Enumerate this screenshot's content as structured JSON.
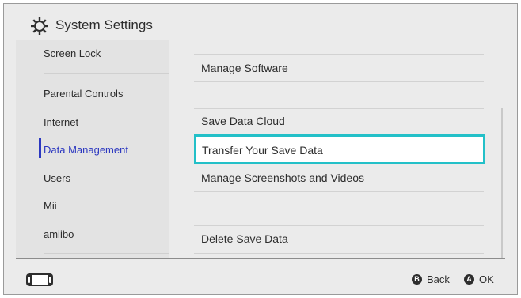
{
  "header": {
    "title": "System Settings",
    "icon": "gear-icon"
  },
  "sidebar": {
    "items": [
      {
        "label": "Screen Lock",
        "active": false
      },
      {
        "label": "Parental Controls",
        "active": false
      },
      {
        "label": "Internet",
        "active": false
      },
      {
        "label": "Data Management",
        "active": true
      },
      {
        "label": "Users",
        "active": false
      },
      {
        "label": "Mii",
        "active": false
      },
      {
        "label": "amiibo",
        "active": false
      }
    ]
  },
  "main": {
    "items": [
      {
        "label": "Manage Software"
      },
      {
        "label": "Save Data Cloud"
      },
      {
        "label": "Transfer Your Save Data",
        "selected": true
      },
      {
        "label": "Manage Screenshots and Videos"
      },
      {
        "label": "Delete Save Data"
      }
    ]
  },
  "footer": {
    "back_key": "B",
    "back_label": "Back",
    "ok_key": "A",
    "ok_label": "OK",
    "console_icon": "console-icon"
  },
  "colors": {
    "accent": "#2c38c0",
    "selection": "#23c0c8",
    "background": "#ebebeb"
  }
}
